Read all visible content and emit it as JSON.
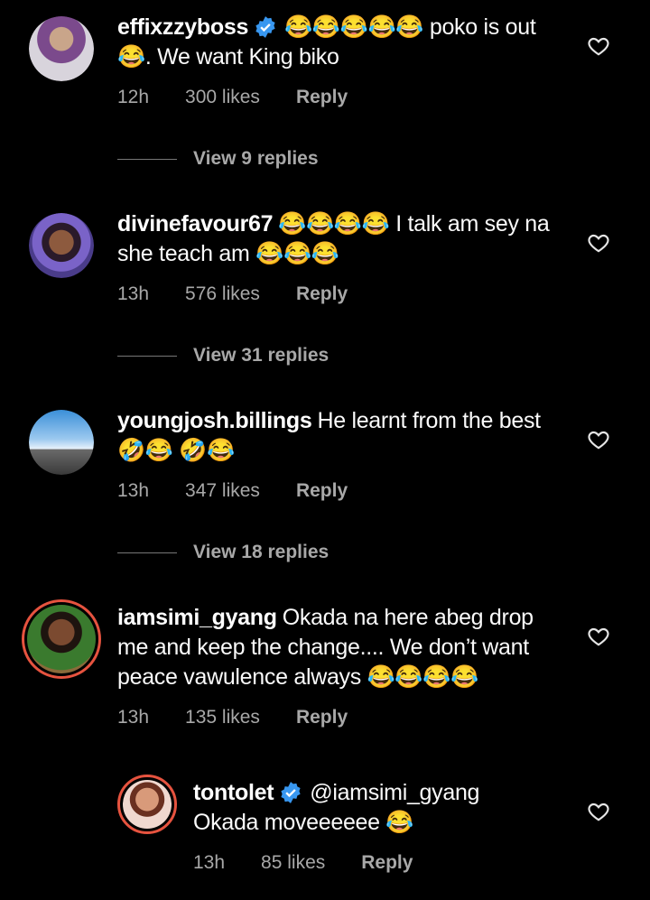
{
  "comments": [
    {
      "username": "effixzzyboss",
      "verified": true,
      "text": "😂😂😂😂😂 poko is out 😂. We want King biko",
      "time": "12h",
      "likes": "300 likes",
      "reply": "Reply",
      "view_replies": "View 9 replies"
    },
    {
      "username": "divinefavour67",
      "verified": false,
      "text": "😂😂😂😂 I talk am sey na she teach am 😂😂😂",
      "time": "13h",
      "likes": "576 likes",
      "reply": "Reply",
      "view_replies": "View 31 replies"
    },
    {
      "username": "youngjosh.billings",
      "verified": false,
      "text": "He learnt from the best 🤣😂 🤣😂",
      "time": "13h",
      "likes": "347 likes",
      "reply": "Reply",
      "view_replies": "View 18 replies"
    },
    {
      "username": "iamsimi_gyang",
      "verified": false,
      "text": "Okada na here abeg drop me and keep the change.... We don’t want peace vawulence always 😂😂😂😂",
      "time": "13h",
      "likes": "135 likes",
      "reply": "Reply"
    }
  ],
  "reply_comment": {
    "username": "tontolet",
    "verified": true,
    "text": "@iamsimi_gyang Okada moveeeeee 😂",
    "time": "13h",
    "likes": "85 likes",
    "reply": "Reply"
  },
  "colors": {
    "background": "#000000",
    "meta_text": "#a8a8a8",
    "verified_badge": "#3897f0",
    "story_ring": "#e6533f"
  }
}
